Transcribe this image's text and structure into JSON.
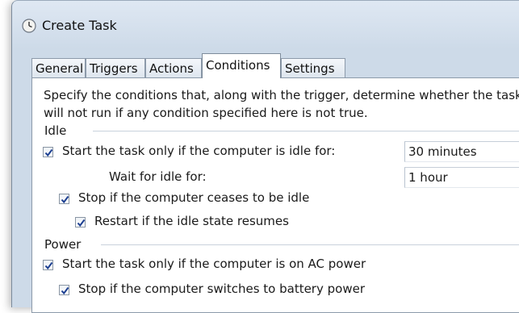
{
  "window": {
    "title": "Create Task"
  },
  "tabs": [
    {
      "label": "General",
      "active": false
    },
    {
      "label": "Triggers",
      "active": false
    },
    {
      "label": "Actions",
      "active": false
    },
    {
      "label": "Conditions",
      "active": true
    },
    {
      "label": "Settings",
      "active": false
    }
  ],
  "description": {
    "line1": "Specify the conditions that, along with the trigger, determine whether the task s",
    "line2": "will not run  if any condition specified here is not true."
  },
  "idle": {
    "label": "Idle",
    "start_idle": {
      "label": "Start the task only if the computer is idle for:",
      "checked": true,
      "value": "30 minutes"
    },
    "wait_idle": {
      "label": "Wait for idle for:",
      "value": "1 hour"
    },
    "stop_idle": {
      "label": "Stop if the computer ceases to be idle",
      "checked": true
    },
    "restart_idle": {
      "label": "Restart if the idle state resumes",
      "checked": true
    }
  },
  "power": {
    "label": "Power",
    "ac_power": {
      "label": "Start the task only if the computer is on AC power",
      "checked": true
    },
    "battery": {
      "label": "Stop if the computer switches to battery power",
      "checked": true
    }
  },
  "colors": {
    "check": "#1c3f91",
    "frame": "#cddae8",
    "border": "#8c9aaa"
  }
}
